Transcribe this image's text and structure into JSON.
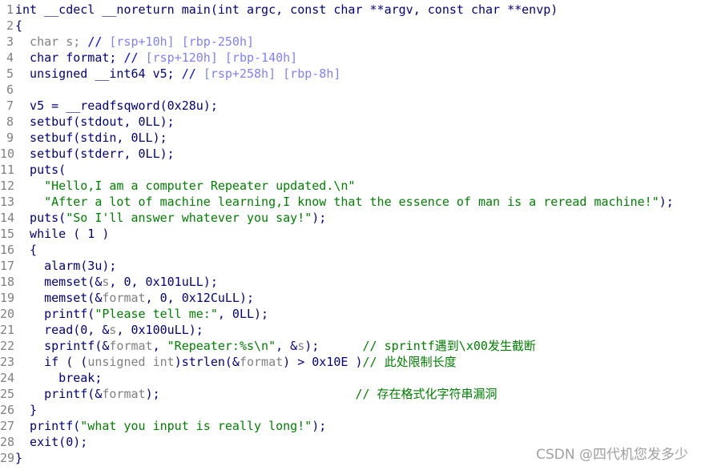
{
  "editor": {
    "lines": [
      [
        [
          "int __cdecl __noreturn main(int argc, const char **argv, const char **envp)",
          "code"
        ]
      ],
      [
        [
          "{",
          "code"
        ]
      ],
      [
        [
          "  char s; ",
          "gray"
        ],
        [
          "// ",
          "slash"
        ],
        [
          "[rsp+10h] [rbp-250h]",
          "addr"
        ]
      ],
      [
        [
          "  char format; ",
          "code"
        ],
        [
          "// ",
          "slash"
        ],
        [
          "[rsp+120h] [rbp-140h]",
          "addr"
        ]
      ],
      [
        [
          "  unsigned __int64 v5; ",
          "code"
        ],
        [
          "// ",
          "slash"
        ],
        [
          "[rsp+258h] [rbp-8h]",
          "addr"
        ]
      ],
      [
        [
          "",
          "code"
        ]
      ],
      [
        [
          "  v5 = __readfsqword(0x28u);",
          "code"
        ]
      ],
      [
        [
          "  setbuf(stdout, 0LL);",
          "code"
        ]
      ],
      [
        [
          "  setbuf(stdin, 0LL);",
          "code"
        ]
      ],
      [
        [
          "  setbuf(stderr, 0LL);",
          "code"
        ]
      ],
      [
        [
          "  puts(",
          "code"
        ]
      ],
      [
        [
          "    ",
          "code"
        ],
        [
          "\"Hello,I am a computer Repeater updated.\\n\"",
          "str"
        ]
      ],
      [
        [
          "    ",
          "code"
        ],
        [
          "\"After a lot of machine learning,I know that the essence of man is a reread machine!\"",
          "str"
        ],
        [
          ");",
          "code"
        ]
      ],
      [
        [
          "  puts(",
          "code"
        ],
        [
          "\"So I'll answer whatever you say!\"",
          "str"
        ],
        [
          ");",
          "code"
        ]
      ],
      [
        [
          "  while ( 1 )",
          "code"
        ]
      ],
      [
        [
          "  {",
          "code"
        ]
      ],
      [
        [
          "    alarm(3u);",
          "code"
        ]
      ],
      [
        [
          "    memset(&",
          "code"
        ],
        [
          "s",
          "gray"
        ],
        [
          ", 0, 0x101uLL);",
          "code"
        ]
      ],
      [
        [
          "    memset(&",
          "code"
        ],
        [
          "format",
          "gray"
        ],
        [
          ", 0, 0x12CuLL);",
          "code"
        ]
      ],
      [
        [
          "    printf(",
          "code"
        ],
        [
          "\"Please tell me:\"",
          "str"
        ],
        [
          ", 0LL);",
          "code"
        ]
      ],
      [
        [
          "    read(0, &",
          "code"
        ],
        [
          "s",
          "gray"
        ],
        [
          ", 0x100uLL);",
          "code"
        ]
      ],
      [
        [
          "    sprintf(&",
          "code"
        ],
        [
          "format",
          "gray"
        ],
        [
          ", ",
          "code"
        ],
        [
          "\"Repeater:%s\\n\"",
          "str"
        ],
        [
          ", &",
          "code"
        ],
        [
          "s",
          "gray"
        ],
        [
          ");      ",
          "code"
        ],
        [
          "// sprintf遇到\\x00发生截断",
          "cmt"
        ]
      ],
      [
        [
          "    if ( (",
          "code"
        ],
        [
          "unsigned int",
          "gray"
        ],
        [
          ")strlen(&",
          "code"
        ],
        [
          "format",
          "gray"
        ],
        [
          ") > 0x10E )",
          "code"
        ],
        [
          "// 此处限制长度",
          "cmt"
        ]
      ],
      [
        [
          "      break;",
          "code"
        ]
      ],
      [
        [
          "    printf(&",
          "code"
        ],
        [
          "format",
          "gray"
        ],
        [
          ");                           ",
          "code"
        ],
        [
          "// 存在格式化字符串漏洞",
          "cmt"
        ]
      ],
      [
        [
          "  }",
          "code"
        ]
      ],
      [
        [
          "  printf(",
          "code"
        ],
        [
          "\"what you input is really long!\"",
          "str"
        ],
        [
          ");",
          "code"
        ]
      ],
      [
        [
          "  exit(0);",
          "code"
        ]
      ],
      [
        [
          "}",
          "code"
        ]
      ]
    ]
  },
  "watermark": "CSDN @四代机您发多少"
}
